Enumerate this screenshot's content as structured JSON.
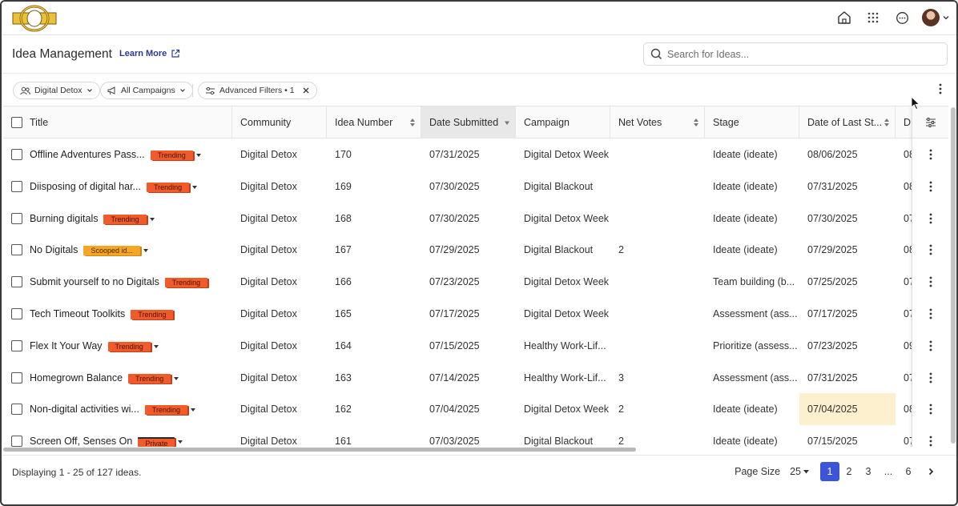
{
  "header": {
    "title": "Idea Management",
    "learn_more": "Learn More",
    "search_placeholder": "Search for Ideas..."
  },
  "filters": {
    "community": "Digital Detox",
    "campaigns": "All Campaigns",
    "advanced": "Advanced Filters • 1"
  },
  "columns": [
    "Title",
    "Community",
    "Idea Number",
    "Date Submitted",
    "Campaign",
    "Net Votes",
    "Stage",
    "Date of Last St...",
    "D"
  ],
  "rows": [
    {
      "title": "Offline Adventures Pass...",
      "badge": "Trending",
      "community": "Digital Detox",
      "number": "170",
      "submitted": "07/31/2025",
      "campaign": "Digital Detox Week",
      "votes": "",
      "stage": "Ideate (ideate)",
      "last": "08/06/2025",
      "d": "08"
    },
    {
      "title": "Diisposing of digital har...",
      "badge": "Trending",
      "community": "Digital Detox",
      "number": "169",
      "submitted": "07/30/2025",
      "campaign": "Digital Blackout",
      "votes": "",
      "stage": "Ideate (ideate)",
      "last": "07/31/2025",
      "d": "08"
    },
    {
      "title": "Burning digitals",
      "badge": "Trending",
      "community": "Digital Detox",
      "number": "168",
      "submitted": "07/30/2025",
      "campaign": "Digital Detox Week",
      "votes": "",
      "stage": "Ideate (ideate)",
      "last": "07/30/2025",
      "d": "07"
    },
    {
      "title": "No Digitals",
      "badge": "Scooped id...",
      "community": "Digital Detox",
      "number": "167",
      "submitted": "07/29/2025",
      "campaign": "Digital Blackout",
      "votes": "2",
      "stage": "Ideate (ideate)",
      "last": "07/29/2025",
      "d": "08"
    },
    {
      "title": "Submit yourself to no Digitals",
      "badge": "Trending",
      "community": "Digital Detox",
      "number": "166",
      "submitted": "07/23/2025",
      "campaign": "Digital Detox Week",
      "votes": "",
      "stage": "Team building (b...",
      "last": "07/25/2025",
      "d": "07"
    },
    {
      "title": "Tech Timeout Toolkits",
      "badge": "Trending",
      "community": "Digital Detox",
      "number": "165",
      "submitted": "07/17/2025",
      "campaign": "Digital Detox Week",
      "votes": "",
      "stage": "Assessment (ass...",
      "last": "07/17/2025",
      "d": "07"
    },
    {
      "title": "Flex It Your Way",
      "badge": "Trending",
      "community": "Digital Detox",
      "number": "164",
      "submitted": "07/15/2025",
      "campaign": "Healthy Work-Lif...",
      "votes": "",
      "stage": "Prioritize (assess...",
      "last": "07/23/2025",
      "d": "09"
    },
    {
      "title": "Homegrown Balance",
      "badge": "Trending",
      "community": "Digital Detox",
      "number": "163",
      "submitted": "07/14/2025",
      "campaign": "Healthy Work-Lif...",
      "votes": "3",
      "stage": "Assessment (ass...",
      "last": "07/31/2025",
      "d": "07"
    },
    {
      "title": "Non-digital activities wi...",
      "badge": "Trending",
      "community": "Digital Detox",
      "number": "162",
      "submitted": "07/04/2025",
      "campaign": "Digital Detox Week",
      "votes": "2",
      "stage": "Ideate (ideate)",
      "last": "07/04/2025",
      "d": "08"
    },
    {
      "title": "Screen Off, Senses On",
      "badge": "Private",
      "community": "Digital Detox",
      "number": "161",
      "submitted": "07/03/2025",
      "campaign": "Digital Blackout",
      "votes": "2",
      "stage": "Ideate (ideate)",
      "last": "07/15/2025",
      "d": "07"
    }
  ],
  "footer": {
    "display": "Displaying 1 - 25 of 127 ideas.",
    "page_size_label": "Page Size",
    "page_size": "25",
    "pages": [
      "1",
      "2",
      "3",
      "...",
      "6"
    ]
  },
  "colors": {
    "accent": "#3c55d8",
    "trending": "#f15a2b",
    "scooped": "#f5a623",
    "highlight": "#fdf0cf"
  }
}
